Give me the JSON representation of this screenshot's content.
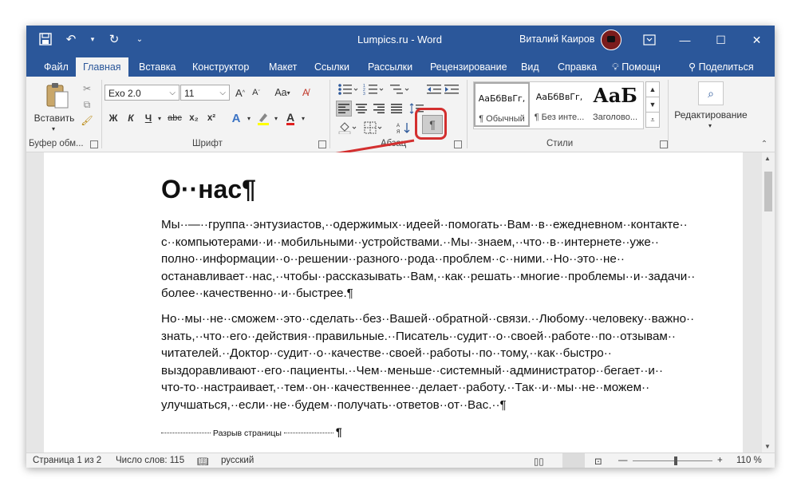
{
  "app": {
    "doc_title": "Lumpics.ru  -  Word",
    "user_name": "Виталий Каиров"
  },
  "qat": {
    "save_icon": "save-icon",
    "undo_icon": "undo-icon",
    "redo_icon": "redo-icon",
    "customize_icon": "customize-qat-icon"
  },
  "tabs": [
    "Файл",
    "Главная",
    "Вставка",
    "Конструктор",
    "Макет",
    "Ссылки",
    "Рассылки",
    "Рецензирование",
    "Вид",
    "Справка",
    "Помощн",
    "Поделиться"
  ],
  "ribbon": {
    "clipboard": {
      "paste_label": "Вставить",
      "group_label": "Буфер обм..."
    },
    "font": {
      "font_name": "Exo 2.0",
      "font_size": "11",
      "bold": "Ж",
      "italic": "К",
      "underline": "Ч",
      "strike": "abc",
      "subscript": "x₂",
      "superscript": "x²",
      "change_case": "Aa",
      "group_label": "Шрифт"
    },
    "paragraph": {
      "pilcrow": "¶",
      "group_label": "Абзац"
    },
    "styles": {
      "items": [
        {
          "sample": "АаБбВвГг,",
          "name": "¶ Обычный"
        },
        {
          "sample": "АаБбВвГг,",
          "name": "¶ Без инте..."
        },
        {
          "sample": "АаБ",
          "name": "Заголово..."
        }
      ],
      "group_label": "Стили"
    },
    "editing": {
      "label": "Редактирование"
    }
  },
  "document": {
    "heading": "О··нас¶",
    "paragraph1": [
      "Мы··—··группа··энтузиастов,··одержимых··идеей··помогать··Вам··в··ежедневном··контакте··",
      "с··компьютерами··и··мобильными··устройствами.··Мы··знаем,··что··в··интернете··уже··",
      "полно··информации··о··решении··разного··рода··проблем··с··ними.··Но··это··не··",
      "останавливает··нас,··чтобы··рассказывать··Вам,··как··решать··многие··проблемы··и··задачи··",
      "более··качественно··и··быстрее.¶"
    ],
    "paragraph2": [
      "Но··мы··не··сможем··это··сделать··без··Вашей··обратной··связи.··Любому··человеку··важно··",
      "знать,··что··его··действия··правильные.··Писатель··судит··о··своей··работе··по··отзывам··",
      "читателей.··Доктор··судит··о··качестве··своей··работы··по··тому,··как··быстро··",
      "выздоравливают··его··пациенты.··Чем··меньше··системный··администратор··бегает··и··",
      "что-то··настраивает,··тем··он··качественнее··делает··работу.··Так··и··мы··не··можем··",
      "улучшаться,··если··не··будем··получать··ответов··от··Вас.··¶"
    ],
    "page_break": "Разрыв страницы",
    "page_break_mark": "¶"
  },
  "status": {
    "page": "Страница 1 из 2",
    "words": "Число слов: 115",
    "language": "русский",
    "zoom": "110 %"
  },
  "colors": {
    "accent": "#2b579a",
    "highlight": "#d32f2f"
  }
}
